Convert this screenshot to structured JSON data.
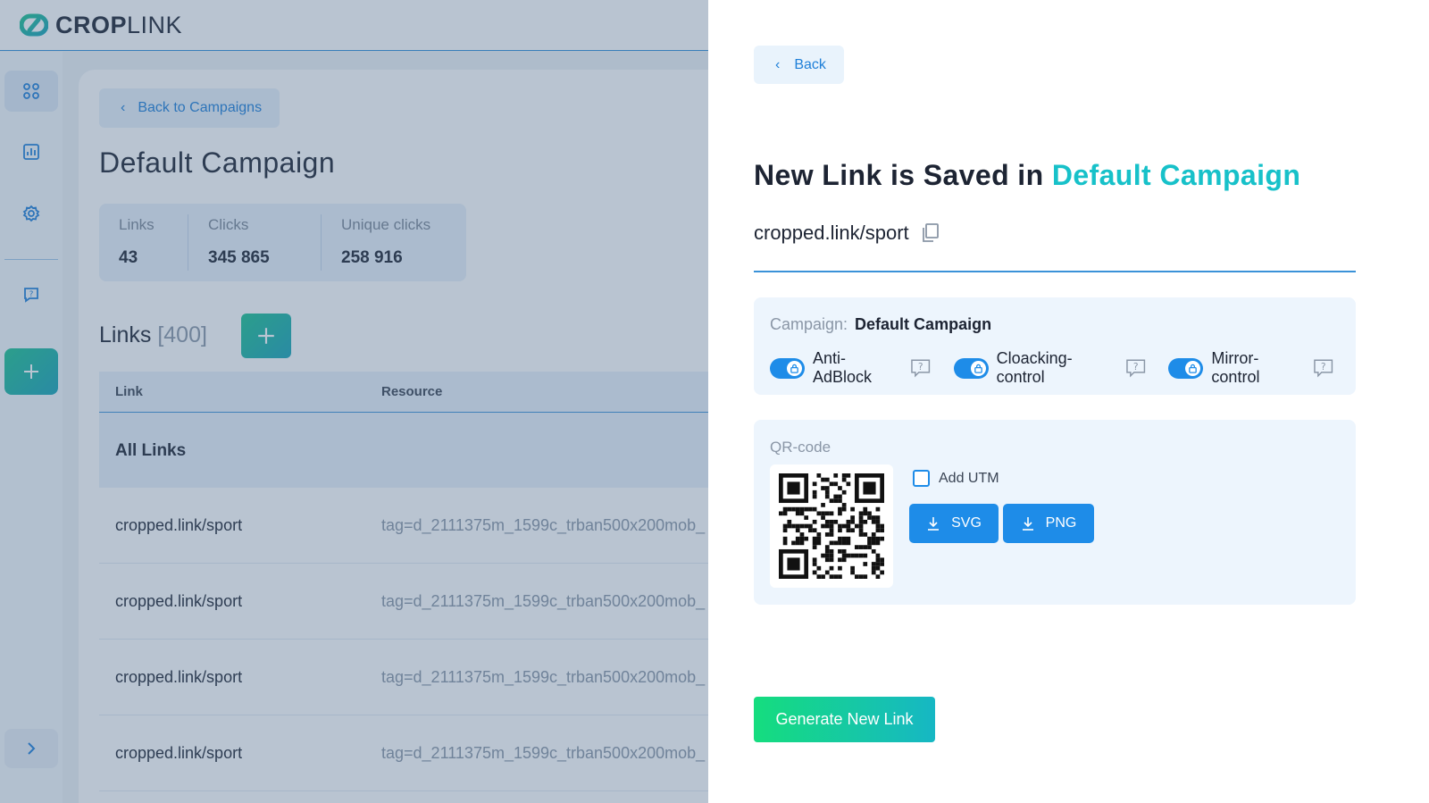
{
  "brand": {
    "name_bold": "CROP",
    "name_light": "LINK",
    "accent": "#17c1c9"
  },
  "sidebar": {
    "items": [
      {
        "icon": "dashboard-icon"
      },
      {
        "icon": "chart-icon"
      },
      {
        "icon": "gear-icon"
      },
      {
        "icon": "help-chat-icon"
      },
      {
        "icon": "plus-icon"
      },
      {
        "icon": "chevron-right-icon"
      }
    ]
  },
  "campaign_page": {
    "back_label": "Back to Campaigns",
    "title": "Default Campaign",
    "stats": [
      {
        "label": "Links",
        "value": "43"
      },
      {
        "label": "Clicks",
        "value": "345 865"
      },
      {
        "label": "Unique clicks",
        "value": "258 916"
      }
    ],
    "links_heading": "Links",
    "links_count": "[400]",
    "table": {
      "columns": [
        "Link",
        "Resource"
      ],
      "group_label": "All Links",
      "rows": [
        {
          "link": "cropped.link/sport",
          "resource": "tag=d_2111375m_1599c_trban500x200mob_"
        },
        {
          "link": "cropped.link/sport",
          "resource": "tag=d_2111375m_1599c_trban500x200mob_"
        },
        {
          "link": "cropped.link/sport",
          "resource": "tag=d_2111375m_1599c_trban500x200mob_"
        },
        {
          "link": "cropped.link/sport",
          "resource": "tag=d_2111375m_1599c_trban500x200mob_"
        }
      ]
    }
  },
  "panel": {
    "back_label": "Back",
    "title_prefix": "New Link is Saved in",
    "title_campaign": "Default Campaign",
    "short_link": "cropped.link/sport",
    "campaign_label": "Campaign:",
    "campaign_value": "Default Campaign",
    "toggles": [
      {
        "label": "Anti-AdBlock",
        "on": true
      },
      {
        "label": "Cloacking-control",
        "on": true
      },
      {
        "label": "Mirror-control",
        "on": true
      }
    ],
    "qr_label": "QR-code",
    "add_utm_label": "Add UTM",
    "download_svg": "SVG",
    "download_png": "PNG",
    "generate_label": "Generate New Link"
  }
}
